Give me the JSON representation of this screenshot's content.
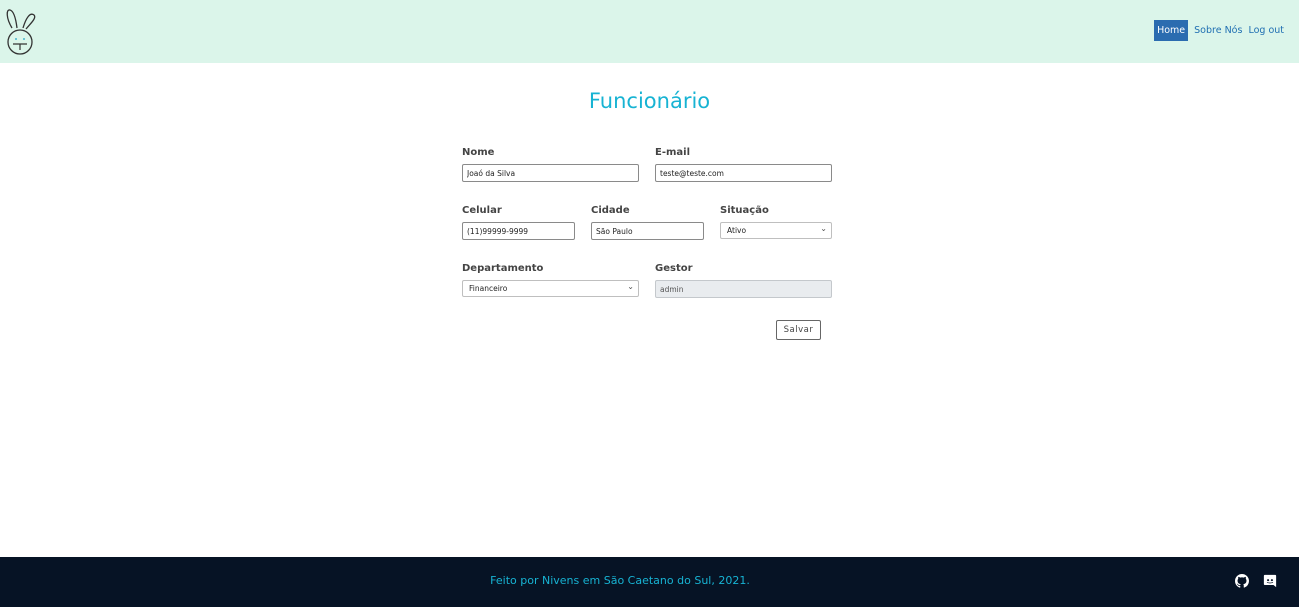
{
  "header": {
    "nav": {
      "home": "Home",
      "about": "Sobre Nós",
      "logout": "Log out"
    }
  },
  "page": {
    "title": "Funcionário"
  },
  "form": {
    "nome": {
      "label": "Nome",
      "value": "Joaó da Silva"
    },
    "email": {
      "label": "E-mail",
      "value": "teste@teste.com"
    },
    "celular": {
      "label": "Celular",
      "value": "(11)99999-9999"
    },
    "cidade": {
      "label": "Cidade",
      "value": "São Paulo"
    },
    "situacao": {
      "label": "Situação",
      "value": "Ativo"
    },
    "departamento": {
      "label": "Departamento",
      "value": "Financeiro"
    },
    "gestor": {
      "label": "Gestor",
      "value": "admin"
    },
    "save_label": "Salvar"
  },
  "footer": {
    "text": "Feito por Nivens em São Caetano do Sul, 2021."
  },
  "colors": {
    "header_bg": "#dbf5ea",
    "accent": "#17b3d3",
    "nav_active": "#2b6cb0",
    "footer_bg": "#061325"
  },
  "icons": {
    "logo": "bunny-logo-icon",
    "github": "github-icon",
    "discord": "discord-icon"
  }
}
